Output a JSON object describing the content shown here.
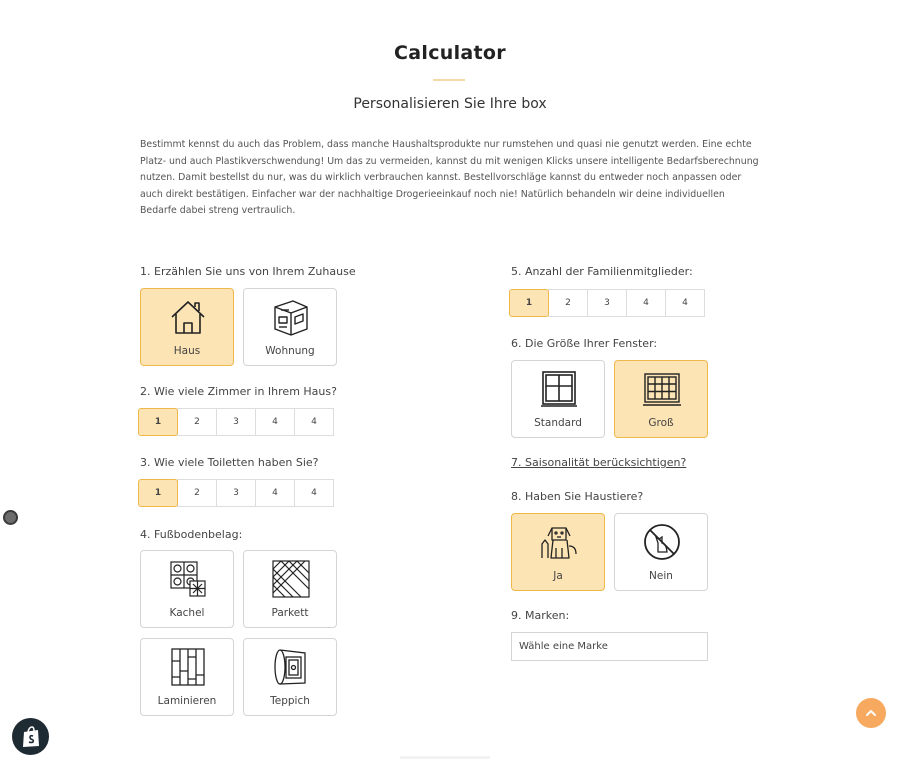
{
  "header": {
    "title": "Calculator",
    "subtitle": "Personalisieren Sie Ihre box",
    "intro": "Bestimmt kennst du auch das Problem, dass manche Haushaltsprodukte nur rumstehen und quasi nie genutzt werden. Eine echte Platz- und auch Plastikverschwendung! Um das zu vermeiden, kannst du mit wenigen Klicks unsere intelligente Bedarfsberechnung nutzen. Damit bestellst du nur, was du wirklich verbrauchen kannst. Bestellvorschläge kannst du entweder noch anpassen oder auch direkt bestätigen. Einfacher war der nachhaltige Drogerieeinkauf noch nie! Natürlich behandeln wir deine individuellen Bedarfe dabei streng vertraulich."
  },
  "colors": {
    "accent": "#f6a95f",
    "selected_bg": "#fde4b4",
    "selected_border": "#f0b84a",
    "divider": "#f5d9a8"
  },
  "q1": {
    "label": "1. Erzählen Sie uns von Ihrem Zuhause",
    "options": [
      {
        "label": "Haus",
        "icon": "house-icon",
        "selected": true
      },
      {
        "label": "Wohnung",
        "icon": "apartment-icon",
        "selected": false
      }
    ]
  },
  "q2": {
    "label": "2. Wie viele Zimmer in Ihrem Haus?",
    "options": [
      "1",
      "2",
      "3",
      "4",
      "4"
    ],
    "selected": "1"
  },
  "q3": {
    "label": "3. Wie viele Toiletten haben Sie?",
    "options": [
      "1",
      "2",
      "3",
      "4",
      "4"
    ],
    "selected": "1"
  },
  "q4": {
    "label": "4. Fußbodenbelag:",
    "options": [
      {
        "label": "Kachel",
        "icon": "tile-icon",
        "selected": false
      },
      {
        "label": "Parkett",
        "icon": "parquet-icon",
        "selected": false
      },
      {
        "label": "Laminieren",
        "icon": "laminate-icon",
        "selected": false
      },
      {
        "label": "Teppich",
        "icon": "carpet-icon",
        "selected": false
      }
    ]
  },
  "q5": {
    "label": "5. Anzahl der Familienmitglieder:",
    "options": [
      "1",
      "2",
      "3",
      "4",
      "4"
    ],
    "selected": "1"
  },
  "q6": {
    "label": "6. Die Größe Ihrer Fenster:",
    "options": [
      {
        "label": "Standard",
        "icon": "window-standard-icon",
        "selected": false
      },
      {
        "label": "Groß",
        "icon": "window-large-icon",
        "selected": true
      }
    ]
  },
  "q7": {
    "label": "7. Saisonalität berücksichtigen?"
  },
  "q8": {
    "label": "8. Haben Sie Haustiere?",
    "options": [
      {
        "label": "Ja",
        "icon": "pets-icon",
        "selected": true
      },
      {
        "label": "Nein",
        "icon": "no-pets-icon",
        "selected": false
      }
    ]
  },
  "q9": {
    "label": "9. Marken:",
    "select_value": "Wähle eine Marke"
  },
  "widgets": {
    "scroll_top_icon": "chevron-up-icon",
    "shopify_icon": "shopify-bag-icon"
  }
}
